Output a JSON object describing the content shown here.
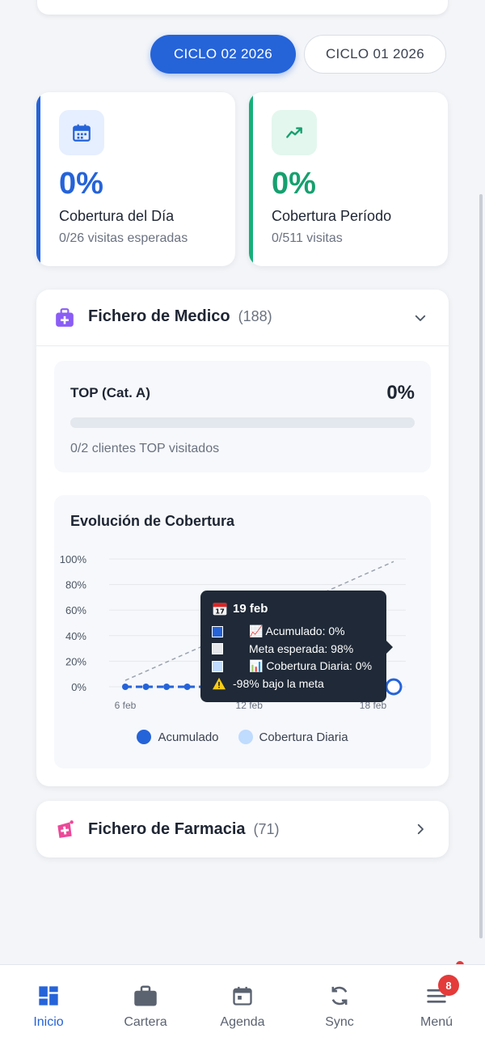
{
  "cycle_tabs": {
    "active": "CICLO 02 2026",
    "inactive": "CICLO 01 2026"
  },
  "kpi_day": {
    "value": "0%",
    "label": "Cobertura del Día",
    "sub": "0/26 visitas esperadas",
    "color": "#2563d9"
  },
  "kpi_period": {
    "value": "0%",
    "label": "Cobertura Período",
    "sub": "0/511 visitas",
    "color": "#16b07a"
  },
  "medico": {
    "title": "Fichero de Medico",
    "count": "(188)",
    "top": {
      "label": "TOP (Cat. A)",
      "pct": "0%",
      "progress": 0,
      "sub": "0/2 clientes TOP visitados"
    },
    "chart_title": "Evolución de Cobertura"
  },
  "chart_data": {
    "type": "line",
    "title": "Evolución de Cobertura",
    "x_ticks": [
      "6 feb",
      "12 feb",
      "18 feb"
    ],
    "y_ticks": [
      "100%",
      "80%",
      "60%",
      "40%",
      "20%",
      "0%"
    ],
    "ylim": [
      0,
      100
    ],
    "series": [
      {
        "name": "Acumulado",
        "color": "#2563d9",
        "points": [
          [
            6,
            0
          ],
          [
            7,
            0
          ],
          [
            8,
            0
          ],
          [
            9,
            0
          ],
          [
            10,
            0
          ],
          [
            11,
            0
          ],
          [
            12,
            0
          ],
          [
            13,
            0
          ],
          [
            14,
            0
          ],
          [
            15,
            0
          ],
          [
            16,
            0
          ],
          [
            17,
            0
          ],
          [
            18,
            0
          ],
          [
            19,
            0
          ]
        ]
      },
      {
        "name": "Meta esperada",
        "color": "#9ca3af",
        "points": [
          [
            6,
            5
          ],
          [
            19,
            98
          ]
        ]
      },
      {
        "name": "Cobertura Diaria",
        "color": "#bfdbfe",
        "points": []
      }
    ],
    "legend": [
      "Acumulado",
      "Cobertura Diaria"
    ],
    "legend_colors": [
      "#2563d9",
      "#bfdbfe"
    ],
    "grid": true,
    "legend_position": "bottom"
  },
  "tooltip": {
    "date": "19 feb",
    "acumulado": "📈 Acumulado: 0%",
    "meta": "Meta esperada: 98%",
    "diaria": "📊 Cobertura Diaria: 0%",
    "warning": "-98% bajo la meta"
  },
  "farmacia": {
    "title": "Fichero de Farmacia",
    "count": "(71)"
  },
  "nav": {
    "items": [
      "Inicio",
      "Cartera",
      "Agenda",
      "Sync",
      "Menú"
    ],
    "badge": "8"
  }
}
